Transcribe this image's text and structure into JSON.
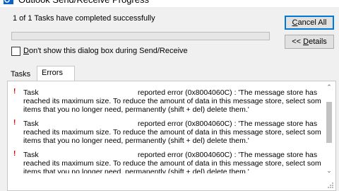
{
  "window": {
    "title": "Outlook Send/Receive Progress"
  },
  "status": {
    "text": "1 of 1 Tasks have completed successfully",
    "progress_fraction": 0
  },
  "buttons": {
    "cancel_all": {
      "prefix": "",
      "underlined": "C",
      "suffix": "ancel All"
    },
    "details": {
      "prefix": "<< ",
      "underlined": "D",
      "suffix": "etails"
    }
  },
  "checkbox": {
    "prefix": "",
    "underlined": "D",
    "suffix": "on't show this dialog box during Send/Receive",
    "checked": false
  },
  "tabs": [
    {
      "label": "Tasks",
      "active": false
    },
    {
      "label": "Errors",
      "active": true
    }
  ],
  "errors": [
    {
      "task_label": "Task",
      "line1_rest": "reported error (0x8004060C) : 'The message store has",
      "line2": "reached its maximum size. To reduce the amount of data in this message store, select some",
      "line3": "items that you no longer need, permanently (shift + del) delete them.'"
    },
    {
      "task_label": "Task",
      "line1_rest": "reported error (0x8004060C) : 'The message store has",
      "line2": "reached its maximum size. To reduce the amount of data in this message store, select some",
      "line3": "items that you no longer need, permanently (shift + del) delete them.'"
    },
    {
      "task_label": "Task",
      "line1_rest": "reported error (0x8004060C) : 'The message store has",
      "line2": "reached its maximum size. To reduce the amount of data in this message store, select some",
      "line3": "items that you no longer need, permanently (shift + del) delete them.'"
    }
  ],
  "icons": {
    "error": "error-icon",
    "title": "outlook-icon",
    "scroll_up": "scroll-up-arrow-icon",
    "scroll_down": "scroll-down-arrow-icon",
    "grip": "resize-grip-icon"
  },
  "colors": {
    "focus_border": "#0078d7",
    "error_icon": "#d00000",
    "panel_bg": "#ffffff",
    "window_bg": "#f0f0f0"
  }
}
